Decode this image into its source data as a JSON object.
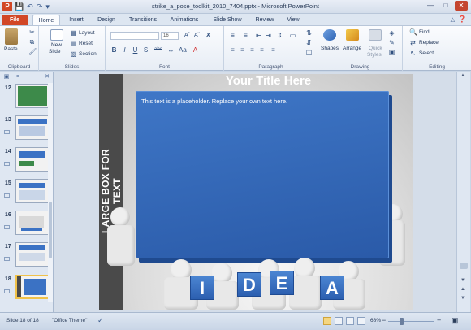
{
  "window": {
    "title": "strike_a_pose_toolkit_2010_7404.pptx - Microsoft PowerPoint",
    "app_icon": "P"
  },
  "tabs": [
    "File",
    "Home",
    "Insert",
    "Design",
    "Transitions",
    "Animations",
    "Slide Show",
    "Review",
    "View"
  ],
  "active_tab": "Home",
  "ribbon": {
    "clipboard": {
      "label": "Clipboard",
      "paste": "Paste"
    },
    "slides": {
      "label": "Slides",
      "new_slide": "New",
      "new_slide_2": "Slide",
      "layout": "Layout",
      "reset": "Reset",
      "section": "Section"
    },
    "font": {
      "label": "Font",
      "size": "16",
      "bold": "B",
      "italic": "I",
      "underline": "U",
      "strike": "S",
      "shadow": "abe"
    },
    "paragraph": {
      "label": "Paragraph"
    },
    "drawing": {
      "label": "Drawing",
      "shapes": "Shapes",
      "arrange": "Arrange",
      "quick_styles": "Quick",
      "quick_styles_2": "Styles"
    },
    "editing": {
      "label": "Editing",
      "find": "Find",
      "replace": "Replace",
      "select": "Select"
    }
  },
  "slide_panel": {
    "items": [
      {
        "num": "12"
      },
      {
        "num": "13"
      },
      {
        "num": "14"
      },
      {
        "num": "15"
      },
      {
        "num": "16"
      },
      {
        "num": "17"
      },
      {
        "num": "18",
        "selected": true
      }
    ]
  },
  "slide": {
    "title": "Your Title Here",
    "side_text": "LARGE BOX FOR TEXT",
    "box_text": "This text is a placeholder.  Replace your own text here.",
    "cubes": [
      "I",
      "D",
      "E",
      "A"
    ]
  },
  "status": {
    "slide_info": "Slide 18 of 18",
    "theme": "\"Office Theme\"",
    "zoom": "68%"
  },
  "colors": {
    "accent": "#d24726",
    "slide_box": "#3b72c4",
    "sidebar": "#4a4a4a"
  }
}
